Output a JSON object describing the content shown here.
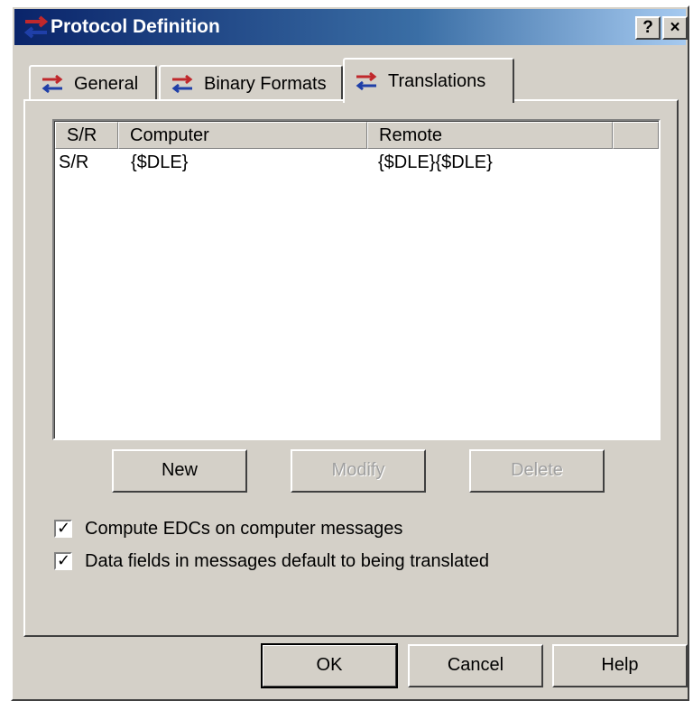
{
  "window": {
    "title": "Protocol Definition",
    "help_button": "?",
    "close_button": "×"
  },
  "tabs": [
    {
      "label": "General",
      "icon": "protocol-arrows-icon"
    },
    {
      "label": "Binary Formats",
      "icon": "protocol-arrows-icon"
    },
    {
      "label": "Translations",
      "icon": "protocol-arrows-icon",
      "selected": true
    }
  ],
  "table": {
    "columns": [
      "S/R",
      "Computer",
      "Remote"
    ],
    "rows": [
      {
        "sr": "S/R",
        "computer": "{$DLE}",
        "remote": "{$DLE}{$DLE}"
      }
    ]
  },
  "buttons": {
    "new": "New",
    "modify": "Modify",
    "delete": "Delete",
    "ok": "OK",
    "cancel": "Cancel",
    "help": "Help"
  },
  "checkboxes": [
    {
      "label": "Compute EDCs on computer messages",
      "checked": true
    },
    {
      "label": "Data fields in messages default to being translated",
      "checked": true
    }
  ],
  "colors": {
    "face": "#d4d0c8",
    "title_start": "#0a246a",
    "title_end": "#a6caf0",
    "icon_red": "#c0282c",
    "icon_blue": "#1f3fa8"
  }
}
